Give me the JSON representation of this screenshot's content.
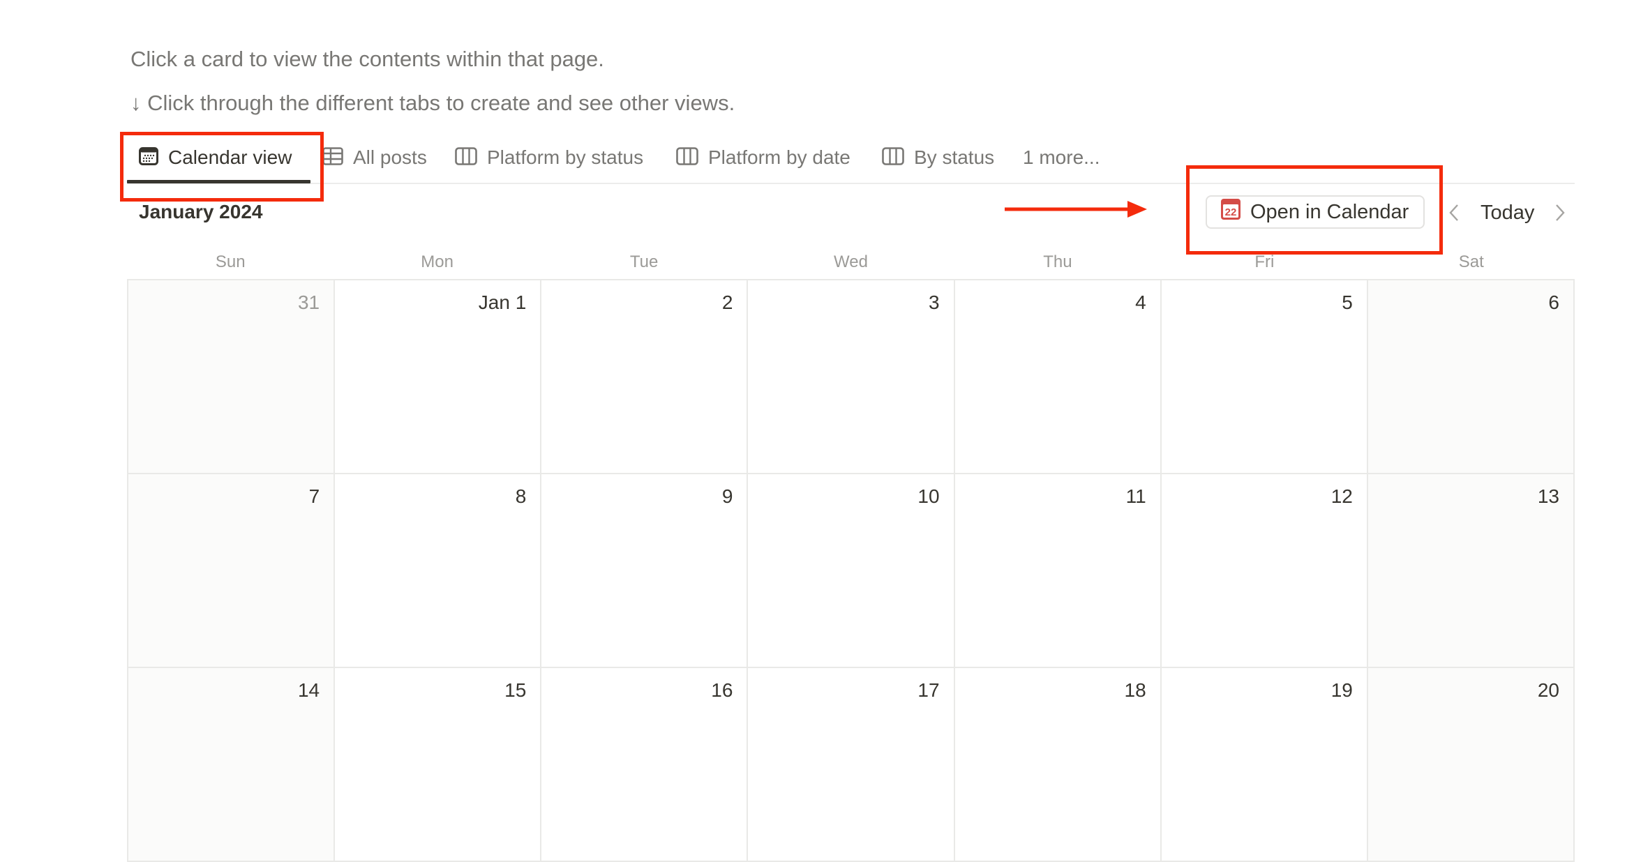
{
  "intro": {
    "line1": "Click a card to view the contents within that page.",
    "line2": "↓ Click through the different tabs to create and see other views."
  },
  "tabs": [
    {
      "label": "Calendar view",
      "icon": "calendar-icon",
      "active": true
    },
    {
      "label": "All posts",
      "icon": "table-icon",
      "active": false
    },
    {
      "label": "Platform by status",
      "icon": "board-icon",
      "active": false
    },
    {
      "label": "Platform by date",
      "icon": "board-icon",
      "active": false
    },
    {
      "label": "By status",
      "icon": "board-icon",
      "active": false
    },
    {
      "label": "1 more...",
      "icon": null,
      "active": false
    }
  ],
  "calendar": {
    "month_title": "January 2024",
    "open_button": {
      "label": "Open in Calendar",
      "icon": "calendar-app-icon",
      "icon_text": "22"
    },
    "today_label": "Today",
    "prev_icon": "chevron-left-icon",
    "next_icon": "chevron-right-icon",
    "weekdays": [
      "Sun",
      "Mon",
      "Tue",
      "Wed",
      "Thu",
      "Fri",
      "Sat"
    ],
    "weeks": [
      [
        {
          "label": "31",
          "other_month": true
        },
        {
          "label": "Jan 1"
        },
        {
          "label": "2"
        },
        {
          "label": "3"
        },
        {
          "label": "4"
        },
        {
          "label": "5"
        },
        {
          "label": "6"
        }
      ],
      [
        {
          "label": "7"
        },
        {
          "label": "8"
        },
        {
          "label": "9"
        },
        {
          "label": "10"
        },
        {
          "label": "11"
        },
        {
          "label": "12"
        },
        {
          "label": "13"
        }
      ],
      [
        {
          "label": "14"
        },
        {
          "label": "15"
        },
        {
          "label": "16"
        },
        {
          "label": "17"
        },
        {
          "label": "18"
        },
        {
          "label": "19"
        },
        {
          "label": "20"
        }
      ]
    ]
  },
  "colors": {
    "annotation": "#f42b0c",
    "text_primary": "#37352f",
    "text_secondary": "#787774",
    "text_muted": "#9b9a97",
    "calendar_icon": "#d44c47",
    "weekend_bg": "#fbfbfa",
    "grid_line": "#e9e9e7"
  }
}
